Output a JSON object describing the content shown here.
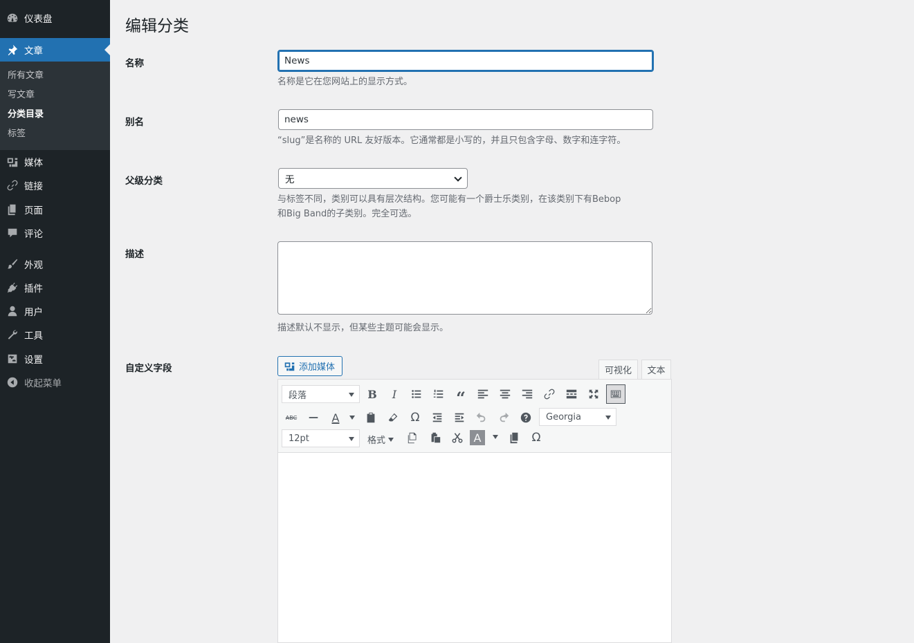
{
  "sidebar": {
    "dashboard": "仪表盘",
    "posts": "文章",
    "posts_sub": [
      "所有文章",
      "写文章",
      "分类目录",
      "标签"
    ],
    "media": "媒体",
    "links": "链接",
    "pages": "页面",
    "comments": "评论",
    "appearance": "外观",
    "plugins": "插件",
    "users": "用户",
    "tools": "工具",
    "settings": "设置",
    "collapse": "收起菜单"
  },
  "page": {
    "title": "编辑分类",
    "name_label": "名称",
    "name_value": "News",
    "name_help": "名称是它在您网站上的显示方式。",
    "slug_label": "别名",
    "slug_value": "news",
    "slug_help": "“slug”是名称的 URL 友好版本。它通常都是小写的，并且只包含字母、数字和连字符。",
    "parent_label": "父级分类",
    "parent_value": "无",
    "parent_help_line1": "与标签不同，类别可以具有层次结构。您可能有一个爵士乐类别，在该类别下有Bebop",
    "parent_help_line2": "和Big Band的子类别。完全可选。",
    "desc_label": "描述",
    "desc_help": "描述默认不显示，但某些主题可能会显示。",
    "custom_label": "自定义字段",
    "add_media": "添加媒体",
    "tab_visual": "可视化",
    "tab_text": "文本"
  },
  "toolbar": {
    "paragraph": "段落",
    "font_family": "Georgia",
    "font_size": "12pt",
    "formats": "格式",
    "strikethrough": "ABC"
  },
  "colors": {
    "accent": "#2271b1",
    "sidebar_bg": "#1d2327",
    "submenu_bg": "#2c3338"
  }
}
